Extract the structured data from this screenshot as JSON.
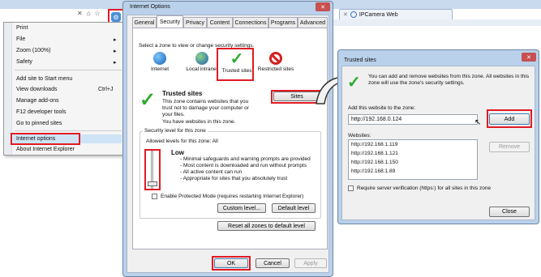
{
  "browser": {
    "address_tab": "IPCamera Web"
  },
  "menu": {
    "items": [
      {
        "label": "Print",
        "chev": ""
      },
      {
        "label": "File",
        "chev": "▸"
      },
      {
        "label": "Zoom (100%)",
        "chev": "▸"
      },
      {
        "label": "Safety",
        "chev": "▸"
      },
      {
        "label": "Add site to Start menu",
        "chev": ""
      },
      {
        "label": "View downloads",
        "chev": "Ctrl+J"
      },
      {
        "label": "Manage add-ons",
        "chev": ""
      },
      {
        "label": "F12 developer tools",
        "chev": ""
      },
      {
        "label": "Go to pinned sites",
        "chev": ""
      },
      {
        "label": "Internet options",
        "chev": ""
      },
      {
        "label": "About Internet Explorer",
        "chev": ""
      }
    ]
  },
  "internet_options": {
    "title": "Internet Options",
    "tabs": [
      "General",
      "Security",
      "Privacy",
      "Content",
      "Connections",
      "Programs",
      "Advanced"
    ],
    "select_zone_text": "Select a zone to view or change security settings.",
    "zones": [
      {
        "label": "Internet"
      },
      {
        "label": "Local intranet"
      },
      {
        "label": "Trusted sites"
      },
      {
        "label": "Restricted sites"
      }
    ],
    "trusted_heading": "Trusted sites",
    "trusted_desc": "This zone contains websites that you trust not to damage your computer or your files.",
    "trusted_note": "You have websites in this zone.",
    "sites_button": "Sites",
    "security_level_label": "Security level for this zone",
    "allowed_levels": "Allowed levels for this zone: All",
    "level_name": "Low",
    "level_bullets": [
      "- Minimal safeguards and warning prompts are provided",
      "- Most content is downloaded and run without prompts",
      "- All active content can run",
      "- Appropriate for sites that you absolutely trust"
    ],
    "protected_mode": "Enable Protected Mode (requires restarting Internet Explorer)",
    "custom_level": "Custom level...",
    "default_level": "Default level",
    "reset_all": "Reset all zones to default level",
    "ok": "OK",
    "cancel": "Cancel",
    "apply": "Apply"
  },
  "trusted_dialog": {
    "title": "Trusted sites",
    "intro": "You can add and remove websites from this zone. All websites in this zone will use the zone's security settings.",
    "add_label": "Add this website to the zone:",
    "add_value": "http://192.168.0.124",
    "add_button": "Add",
    "websites_label": "Websites:",
    "websites": [
      "http://192.168.1.119",
      "http://192.168.1.121",
      "http://192.168.1.150",
      "http://192.168.1.89"
    ],
    "remove_button": "Remove",
    "require_https": "Require server verification (https:) for all sites in this zone",
    "close_button": "Close"
  },
  "colors": {
    "highlight_red": "#e01b24",
    "check_green": "#2eaa2e",
    "menu_selected": "#cfe3f7"
  }
}
